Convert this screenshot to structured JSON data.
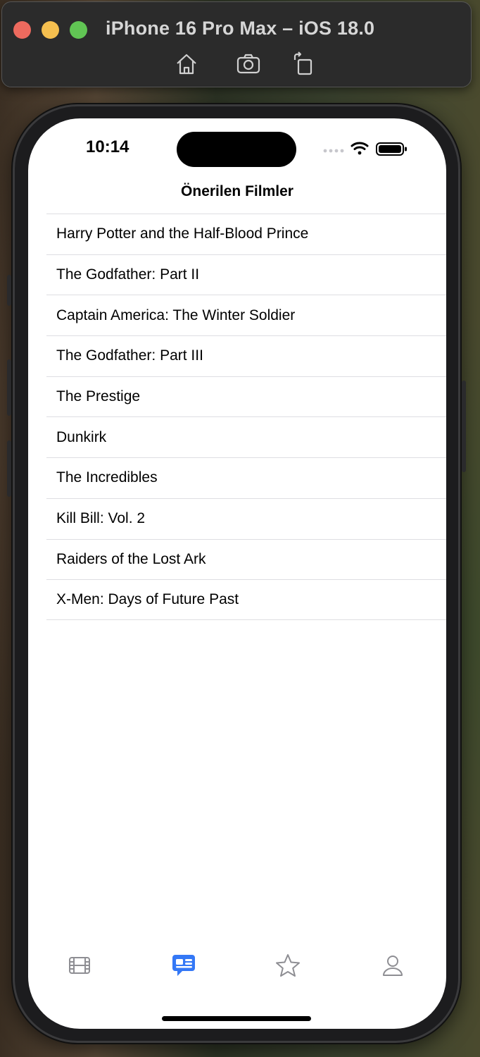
{
  "simulator": {
    "title": "iPhone 16 Pro Max – iOS 18.0",
    "toolbar_icons": [
      "home-icon",
      "screenshot-icon",
      "rotate-icon"
    ]
  },
  "status_bar": {
    "time": "10:14",
    "icons": [
      "cellular-dots-icon",
      "wifi-icon",
      "battery-icon"
    ]
  },
  "nav": {
    "title": "Önerilen Filmler"
  },
  "movies": [
    "Harry Potter and the Half-Blood Prince",
    "The Godfather: Part II",
    "Captain America: The Winter Soldier",
    "The Godfather: Part III",
    "The Prestige",
    "Dunkirk",
    "The Incredibles",
    "Kill Bill: Vol. 2",
    "Raiders of the Lost Ark",
    "X-Men: Days of Future Past"
  ],
  "tabbar": {
    "tabs": [
      {
        "icon": "film-icon",
        "selected": false
      },
      {
        "icon": "recommendations-icon",
        "selected": true
      },
      {
        "icon": "star-icon",
        "selected": false
      },
      {
        "icon": "person-icon",
        "selected": false
      }
    ],
    "accent_color": "#3478f6",
    "inactive_color": "#8e8e93"
  }
}
